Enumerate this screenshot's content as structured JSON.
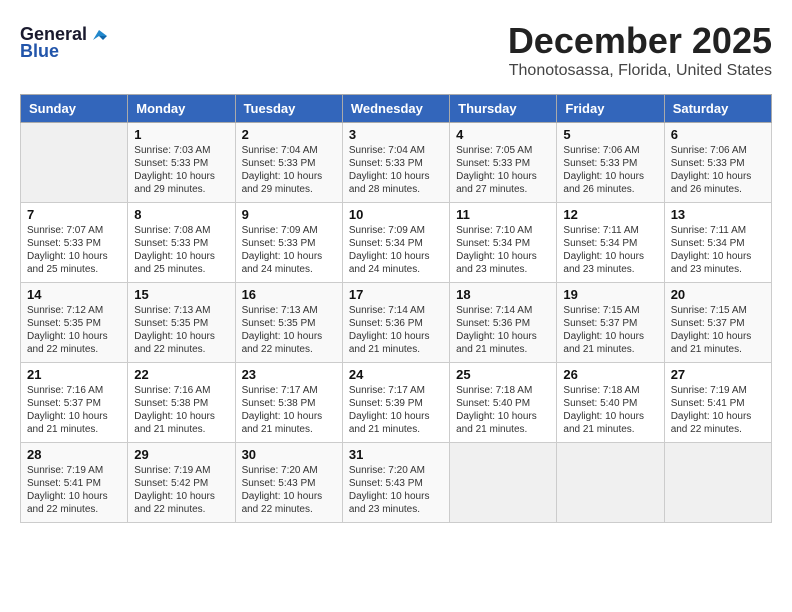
{
  "app": {
    "logo_text_general": "General",
    "logo_text_blue": "Blue",
    "title": "December 2025",
    "subtitle": "Thonotosassa, Florida, United States"
  },
  "calendar": {
    "days_of_week": [
      "Sunday",
      "Monday",
      "Tuesday",
      "Wednesday",
      "Thursday",
      "Friday",
      "Saturday"
    ],
    "weeks": [
      [
        {
          "day": "",
          "info": ""
        },
        {
          "day": "1",
          "info": "Sunrise: 7:03 AM\nSunset: 5:33 PM\nDaylight: 10 hours\nand 29 minutes."
        },
        {
          "day": "2",
          "info": "Sunrise: 7:04 AM\nSunset: 5:33 PM\nDaylight: 10 hours\nand 29 minutes."
        },
        {
          "day": "3",
          "info": "Sunrise: 7:04 AM\nSunset: 5:33 PM\nDaylight: 10 hours\nand 28 minutes."
        },
        {
          "day": "4",
          "info": "Sunrise: 7:05 AM\nSunset: 5:33 PM\nDaylight: 10 hours\nand 27 minutes."
        },
        {
          "day": "5",
          "info": "Sunrise: 7:06 AM\nSunset: 5:33 PM\nDaylight: 10 hours\nand 26 minutes."
        },
        {
          "day": "6",
          "info": "Sunrise: 7:06 AM\nSunset: 5:33 PM\nDaylight: 10 hours\nand 26 minutes."
        }
      ],
      [
        {
          "day": "7",
          "info": "Sunrise: 7:07 AM\nSunset: 5:33 PM\nDaylight: 10 hours\nand 25 minutes."
        },
        {
          "day": "8",
          "info": "Sunrise: 7:08 AM\nSunset: 5:33 PM\nDaylight: 10 hours\nand 25 minutes."
        },
        {
          "day": "9",
          "info": "Sunrise: 7:09 AM\nSunset: 5:33 PM\nDaylight: 10 hours\nand 24 minutes."
        },
        {
          "day": "10",
          "info": "Sunrise: 7:09 AM\nSunset: 5:34 PM\nDaylight: 10 hours\nand 24 minutes."
        },
        {
          "day": "11",
          "info": "Sunrise: 7:10 AM\nSunset: 5:34 PM\nDaylight: 10 hours\nand 23 minutes."
        },
        {
          "day": "12",
          "info": "Sunrise: 7:11 AM\nSunset: 5:34 PM\nDaylight: 10 hours\nand 23 minutes."
        },
        {
          "day": "13",
          "info": "Sunrise: 7:11 AM\nSunset: 5:34 PM\nDaylight: 10 hours\nand 23 minutes."
        }
      ],
      [
        {
          "day": "14",
          "info": "Sunrise: 7:12 AM\nSunset: 5:35 PM\nDaylight: 10 hours\nand 22 minutes."
        },
        {
          "day": "15",
          "info": "Sunrise: 7:13 AM\nSunset: 5:35 PM\nDaylight: 10 hours\nand 22 minutes."
        },
        {
          "day": "16",
          "info": "Sunrise: 7:13 AM\nSunset: 5:35 PM\nDaylight: 10 hours\nand 22 minutes."
        },
        {
          "day": "17",
          "info": "Sunrise: 7:14 AM\nSunset: 5:36 PM\nDaylight: 10 hours\nand 21 minutes."
        },
        {
          "day": "18",
          "info": "Sunrise: 7:14 AM\nSunset: 5:36 PM\nDaylight: 10 hours\nand 21 minutes."
        },
        {
          "day": "19",
          "info": "Sunrise: 7:15 AM\nSunset: 5:37 PM\nDaylight: 10 hours\nand 21 minutes."
        },
        {
          "day": "20",
          "info": "Sunrise: 7:15 AM\nSunset: 5:37 PM\nDaylight: 10 hours\nand 21 minutes."
        }
      ],
      [
        {
          "day": "21",
          "info": "Sunrise: 7:16 AM\nSunset: 5:37 PM\nDaylight: 10 hours\nand 21 minutes."
        },
        {
          "day": "22",
          "info": "Sunrise: 7:16 AM\nSunset: 5:38 PM\nDaylight: 10 hours\nand 21 minutes."
        },
        {
          "day": "23",
          "info": "Sunrise: 7:17 AM\nSunset: 5:38 PM\nDaylight: 10 hours\nand 21 minutes."
        },
        {
          "day": "24",
          "info": "Sunrise: 7:17 AM\nSunset: 5:39 PM\nDaylight: 10 hours\nand 21 minutes."
        },
        {
          "day": "25",
          "info": "Sunrise: 7:18 AM\nSunset: 5:40 PM\nDaylight: 10 hours\nand 21 minutes."
        },
        {
          "day": "26",
          "info": "Sunrise: 7:18 AM\nSunset: 5:40 PM\nDaylight: 10 hours\nand 21 minutes."
        },
        {
          "day": "27",
          "info": "Sunrise: 7:19 AM\nSunset: 5:41 PM\nDaylight: 10 hours\nand 22 minutes."
        }
      ],
      [
        {
          "day": "28",
          "info": "Sunrise: 7:19 AM\nSunset: 5:41 PM\nDaylight: 10 hours\nand 22 minutes."
        },
        {
          "day": "29",
          "info": "Sunrise: 7:19 AM\nSunset: 5:42 PM\nDaylight: 10 hours\nand 22 minutes."
        },
        {
          "day": "30",
          "info": "Sunrise: 7:20 AM\nSunset: 5:43 PM\nDaylight: 10 hours\nand 22 minutes."
        },
        {
          "day": "31",
          "info": "Sunrise: 7:20 AM\nSunset: 5:43 PM\nDaylight: 10 hours\nand 23 minutes."
        },
        {
          "day": "",
          "info": ""
        },
        {
          "day": "",
          "info": ""
        },
        {
          "day": "",
          "info": ""
        }
      ]
    ]
  }
}
